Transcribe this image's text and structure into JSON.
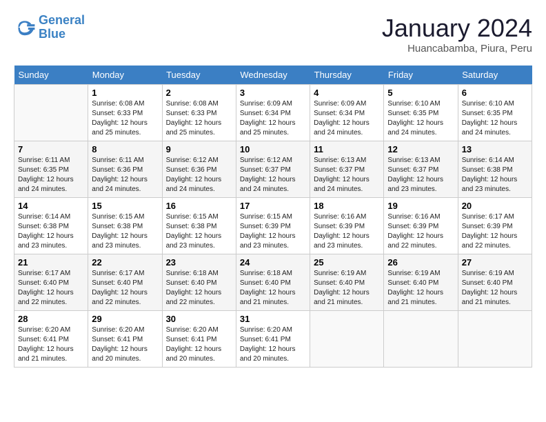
{
  "header": {
    "logo_line1": "General",
    "logo_line2": "Blue",
    "month": "January 2024",
    "location": "Huancabamba, Piura, Peru"
  },
  "days_of_week": [
    "Sunday",
    "Monday",
    "Tuesday",
    "Wednesday",
    "Thursday",
    "Friday",
    "Saturday"
  ],
  "weeks": [
    [
      {
        "num": "",
        "info": ""
      },
      {
        "num": "1",
        "info": "Sunrise: 6:08 AM\nSunset: 6:33 PM\nDaylight: 12 hours\nand 25 minutes."
      },
      {
        "num": "2",
        "info": "Sunrise: 6:08 AM\nSunset: 6:33 PM\nDaylight: 12 hours\nand 25 minutes."
      },
      {
        "num": "3",
        "info": "Sunrise: 6:09 AM\nSunset: 6:34 PM\nDaylight: 12 hours\nand 25 minutes."
      },
      {
        "num": "4",
        "info": "Sunrise: 6:09 AM\nSunset: 6:34 PM\nDaylight: 12 hours\nand 24 minutes."
      },
      {
        "num": "5",
        "info": "Sunrise: 6:10 AM\nSunset: 6:35 PM\nDaylight: 12 hours\nand 24 minutes."
      },
      {
        "num": "6",
        "info": "Sunrise: 6:10 AM\nSunset: 6:35 PM\nDaylight: 12 hours\nand 24 minutes."
      }
    ],
    [
      {
        "num": "7",
        "info": "Sunrise: 6:11 AM\nSunset: 6:35 PM\nDaylight: 12 hours\nand 24 minutes."
      },
      {
        "num": "8",
        "info": "Sunrise: 6:11 AM\nSunset: 6:36 PM\nDaylight: 12 hours\nand 24 minutes."
      },
      {
        "num": "9",
        "info": "Sunrise: 6:12 AM\nSunset: 6:36 PM\nDaylight: 12 hours\nand 24 minutes."
      },
      {
        "num": "10",
        "info": "Sunrise: 6:12 AM\nSunset: 6:37 PM\nDaylight: 12 hours\nand 24 minutes."
      },
      {
        "num": "11",
        "info": "Sunrise: 6:13 AM\nSunset: 6:37 PM\nDaylight: 12 hours\nand 24 minutes."
      },
      {
        "num": "12",
        "info": "Sunrise: 6:13 AM\nSunset: 6:37 PM\nDaylight: 12 hours\nand 23 minutes."
      },
      {
        "num": "13",
        "info": "Sunrise: 6:14 AM\nSunset: 6:38 PM\nDaylight: 12 hours\nand 23 minutes."
      }
    ],
    [
      {
        "num": "14",
        "info": "Sunrise: 6:14 AM\nSunset: 6:38 PM\nDaylight: 12 hours\nand 23 minutes."
      },
      {
        "num": "15",
        "info": "Sunrise: 6:15 AM\nSunset: 6:38 PM\nDaylight: 12 hours\nand 23 minutes."
      },
      {
        "num": "16",
        "info": "Sunrise: 6:15 AM\nSunset: 6:38 PM\nDaylight: 12 hours\nand 23 minutes."
      },
      {
        "num": "17",
        "info": "Sunrise: 6:15 AM\nSunset: 6:39 PM\nDaylight: 12 hours\nand 23 minutes."
      },
      {
        "num": "18",
        "info": "Sunrise: 6:16 AM\nSunset: 6:39 PM\nDaylight: 12 hours\nand 23 minutes."
      },
      {
        "num": "19",
        "info": "Sunrise: 6:16 AM\nSunset: 6:39 PM\nDaylight: 12 hours\nand 22 minutes."
      },
      {
        "num": "20",
        "info": "Sunrise: 6:17 AM\nSunset: 6:39 PM\nDaylight: 12 hours\nand 22 minutes."
      }
    ],
    [
      {
        "num": "21",
        "info": "Sunrise: 6:17 AM\nSunset: 6:40 PM\nDaylight: 12 hours\nand 22 minutes."
      },
      {
        "num": "22",
        "info": "Sunrise: 6:17 AM\nSunset: 6:40 PM\nDaylight: 12 hours\nand 22 minutes."
      },
      {
        "num": "23",
        "info": "Sunrise: 6:18 AM\nSunset: 6:40 PM\nDaylight: 12 hours\nand 22 minutes."
      },
      {
        "num": "24",
        "info": "Sunrise: 6:18 AM\nSunset: 6:40 PM\nDaylight: 12 hours\nand 21 minutes."
      },
      {
        "num": "25",
        "info": "Sunrise: 6:19 AM\nSunset: 6:40 PM\nDaylight: 12 hours\nand 21 minutes."
      },
      {
        "num": "26",
        "info": "Sunrise: 6:19 AM\nSunset: 6:40 PM\nDaylight: 12 hours\nand 21 minutes."
      },
      {
        "num": "27",
        "info": "Sunrise: 6:19 AM\nSunset: 6:40 PM\nDaylight: 12 hours\nand 21 minutes."
      }
    ],
    [
      {
        "num": "28",
        "info": "Sunrise: 6:20 AM\nSunset: 6:41 PM\nDaylight: 12 hours\nand 21 minutes."
      },
      {
        "num": "29",
        "info": "Sunrise: 6:20 AM\nSunset: 6:41 PM\nDaylight: 12 hours\nand 20 minutes."
      },
      {
        "num": "30",
        "info": "Sunrise: 6:20 AM\nSunset: 6:41 PM\nDaylight: 12 hours\nand 20 minutes."
      },
      {
        "num": "31",
        "info": "Sunrise: 6:20 AM\nSunset: 6:41 PM\nDaylight: 12 hours\nand 20 minutes."
      },
      {
        "num": "",
        "info": ""
      },
      {
        "num": "",
        "info": ""
      },
      {
        "num": "",
        "info": ""
      }
    ]
  ]
}
